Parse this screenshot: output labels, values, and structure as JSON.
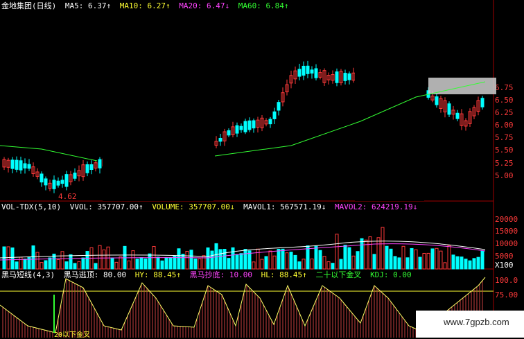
{
  "price_header": {
    "title": "金地集团(日线)",
    "ma5": "MA5: 6.37↑",
    "ma10": "MA10: 6.27↑",
    "ma20": "MA20: 6.47↓",
    "ma60": "MA60: 6.84↑"
  },
  "price_axis": [
    "6.75",
    "6.50",
    "6.25",
    "6.00",
    "5.75",
    "5.50",
    "5.25",
    "5.00"
  ],
  "low_marker": "4.62",
  "volume_header": {
    "indicator": "VOL-TDX(5,10)",
    "vvol": "VVOL: 357707.00↑",
    "volume": "VOLUME: 357707.00↓",
    "mavol1": "MAVOL1: 567571.19↓",
    "mavol2": "MAVOL2: 624219.19↓"
  },
  "volume_axis": [
    "20000",
    "15000",
    "10000",
    "5000",
    "X100"
  ],
  "osc_header": {
    "indicator": "黑马短线(4,3)",
    "escape": "黑马逃顶: 80.00",
    "hy": "HY: 88.45↑",
    "heima": "黑马抄底: 10.00",
    "hl": "HL: 88.45↑",
    "cross": "二十以下金叉",
    "kdj": "KDJ: 0.00"
  },
  "osc_axis": [
    "100.0",
    "75.00"
  ],
  "osc_marker": "20以下金叉",
  "watermark": "www.7gpzb.com",
  "colors": {
    "up": "#ff3a3a",
    "down": "#00ffff",
    "ma5": "#ffffff",
    "ma10": "#ffff33",
    "ma20": "#ff44ff",
    "ma60": "#33ff33"
  }
}
